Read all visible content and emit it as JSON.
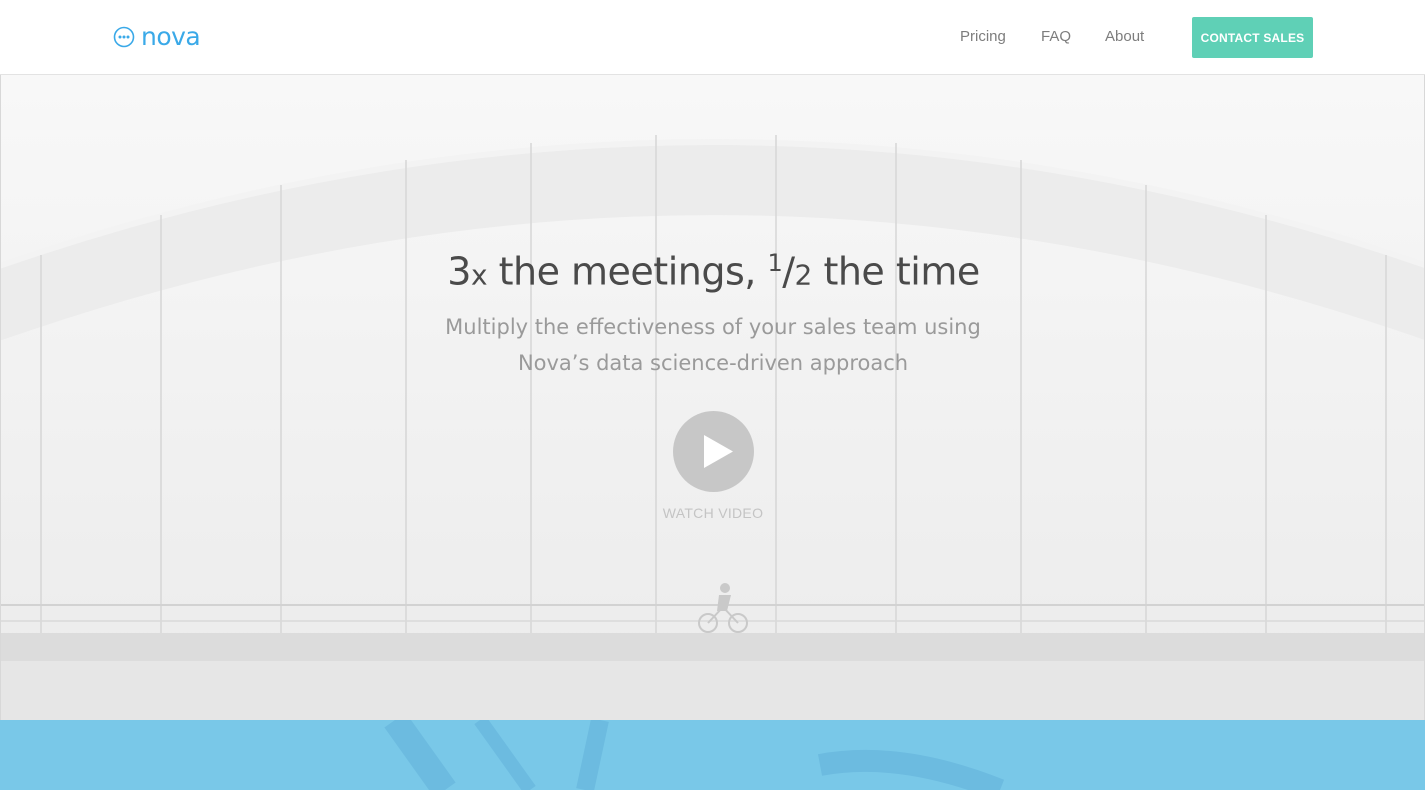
{
  "brand": {
    "name": "nova",
    "color": "#3aa9e8"
  },
  "nav": {
    "items": [
      {
        "label": "Pricing"
      },
      {
        "label": "FAQ"
      },
      {
        "label": "About"
      }
    ],
    "cta_label": "CONTACT SALES",
    "cta_color": "#5fd0b6"
  },
  "hero": {
    "headline": {
      "multiplier": "3",
      "multiplier_unit": "x",
      "part1": " the meetings, ",
      "fraction_num": "1",
      "fraction_slash": "/",
      "fraction_den": "2",
      "part2": " the time"
    },
    "subheadline": "Multiply the effectiveness of your sales team using Nova’s data science-driven approach",
    "video_label": "WATCH VIDEO",
    "play_icon": "play-icon"
  },
  "band_color": "#79c8e8"
}
